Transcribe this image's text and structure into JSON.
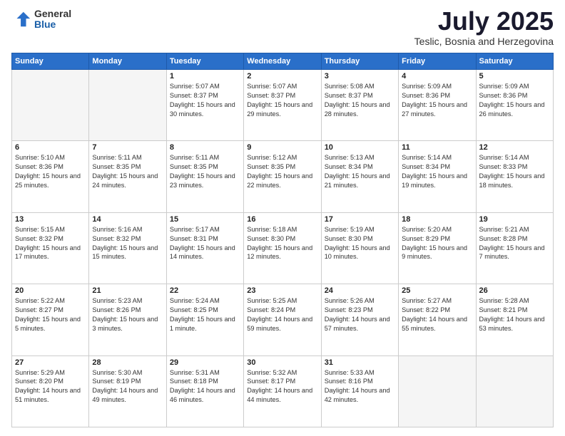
{
  "logo": {
    "general": "General",
    "blue": "Blue"
  },
  "header": {
    "month": "July 2025",
    "location": "Teslic, Bosnia and Herzegovina"
  },
  "weekdays": [
    "Sunday",
    "Monday",
    "Tuesday",
    "Wednesday",
    "Thursday",
    "Friday",
    "Saturday"
  ],
  "weeks": [
    [
      {
        "day": "",
        "info": ""
      },
      {
        "day": "",
        "info": ""
      },
      {
        "day": "1",
        "info": "Sunrise: 5:07 AM\nSunset: 8:37 PM\nDaylight: 15 hours\nand 30 minutes."
      },
      {
        "day": "2",
        "info": "Sunrise: 5:07 AM\nSunset: 8:37 PM\nDaylight: 15 hours\nand 29 minutes."
      },
      {
        "day": "3",
        "info": "Sunrise: 5:08 AM\nSunset: 8:37 PM\nDaylight: 15 hours\nand 28 minutes."
      },
      {
        "day": "4",
        "info": "Sunrise: 5:09 AM\nSunset: 8:36 PM\nDaylight: 15 hours\nand 27 minutes."
      },
      {
        "day": "5",
        "info": "Sunrise: 5:09 AM\nSunset: 8:36 PM\nDaylight: 15 hours\nand 26 minutes."
      }
    ],
    [
      {
        "day": "6",
        "info": "Sunrise: 5:10 AM\nSunset: 8:36 PM\nDaylight: 15 hours\nand 25 minutes."
      },
      {
        "day": "7",
        "info": "Sunrise: 5:11 AM\nSunset: 8:35 PM\nDaylight: 15 hours\nand 24 minutes."
      },
      {
        "day": "8",
        "info": "Sunrise: 5:11 AM\nSunset: 8:35 PM\nDaylight: 15 hours\nand 23 minutes."
      },
      {
        "day": "9",
        "info": "Sunrise: 5:12 AM\nSunset: 8:35 PM\nDaylight: 15 hours\nand 22 minutes."
      },
      {
        "day": "10",
        "info": "Sunrise: 5:13 AM\nSunset: 8:34 PM\nDaylight: 15 hours\nand 21 minutes."
      },
      {
        "day": "11",
        "info": "Sunrise: 5:14 AM\nSunset: 8:34 PM\nDaylight: 15 hours\nand 19 minutes."
      },
      {
        "day": "12",
        "info": "Sunrise: 5:14 AM\nSunset: 8:33 PM\nDaylight: 15 hours\nand 18 minutes."
      }
    ],
    [
      {
        "day": "13",
        "info": "Sunrise: 5:15 AM\nSunset: 8:32 PM\nDaylight: 15 hours\nand 17 minutes."
      },
      {
        "day": "14",
        "info": "Sunrise: 5:16 AM\nSunset: 8:32 PM\nDaylight: 15 hours\nand 15 minutes."
      },
      {
        "day": "15",
        "info": "Sunrise: 5:17 AM\nSunset: 8:31 PM\nDaylight: 15 hours\nand 14 minutes."
      },
      {
        "day": "16",
        "info": "Sunrise: 5:18 AM\nSunset: 8:30 PM\nDaylight: 15 hours\nand 12 minutes."
      },
      {
        "day": "17",
        "info": "Sunrise: 5:19 AM\nSunset: 8:30 PM\nDaylight: 15 hours\nand 10 minutes."
      },
      {
        "day": "18",
        "info": "Sunrise: 5:20 AM\nSunset: 8:29 PM\nDaylight: 15 hours\nand 9 minutes."
      },
      {
        "day": "19",
        "info": "Sunrise: 5:21 AM\nSunset: 8:28 PM\nDaylight: 15 hours\nand 7 minutes."
      }
    ],
    [
      {
        "day": "20",
        "info": "Sunrise: 5:22 AM\nSunset: 8:27 PM\nDaylight: 15 hours\nand 5 minutes."
      },
      {
        "day": "21",
        "info": "Sunrise: 5:23 AM\nSunset: 8:26 PM\nDaylight: 15 hours\nand 3 minutes."
      },
      {
        "day": "22",
        "info": "Sunrise: 5:24 AM\nSunset: 8:25 PM\nDaylight: 15 hours\nand 1 minute."
      },
      {
        "day": "23",
        "info": "Sunrise: 5:25 AM\nSunset: 8:24 PM\nDaylight: 14 hours\nand 59 minutes."
      },
      {
        "day": "24",
        "info": "Sunrise: 5:26 AM\nSunset: 8:23 PM\nDaylight: 14 hours\nand 57 minutes."
      },
      {
        "day": "25",
        "info": "Sunrise: 5:27 AM\nSunset: 8:22 PM\nDaylight: 14 hours\nand 55 minutes."
      },
      {
        "day": "26",
        "info": "Sunrise: 5:28 AM\nSunset: 8:21 PM\nDaylight: 14 hours\nand 53 minutes."
      }
    ],
    [
      {
        "day": "27",
        "info": "Sunrise: 5:29 AM\nSunset: 8:20 PM\nDaylight: 14 hours\nand 51 minutes."
      },
      {
        "day": "28",
        "info": "Sunrise: 5:30 AM\nSunset: 8:19 PM\nDaylight: 14 hours\nand 49 minutes."
      },
      {
        "day": "29",
        "info": "Sunrise: 5:31 AM\nSunset: 8:18 PM\nDaylight: 14 hours\nand 46 minutes."
      },
      {
        "day": "30",
        "info": "Sunrise: 5:32 AM\nSunset: 8:17 PM\nDaylight: 14 hours\nand 44 minutes."
      },
      {
        "day": "31",
        "info": "Sunrise: 5:33 AM\nSunset: 8:16 PM\nDaylight: 14 hours\nand 42 minutes."
      },
      {
        "day": "",
        "info": ""
      },
      {
        "day": "",
        "info": ""
      }
    ]
  ]
}
